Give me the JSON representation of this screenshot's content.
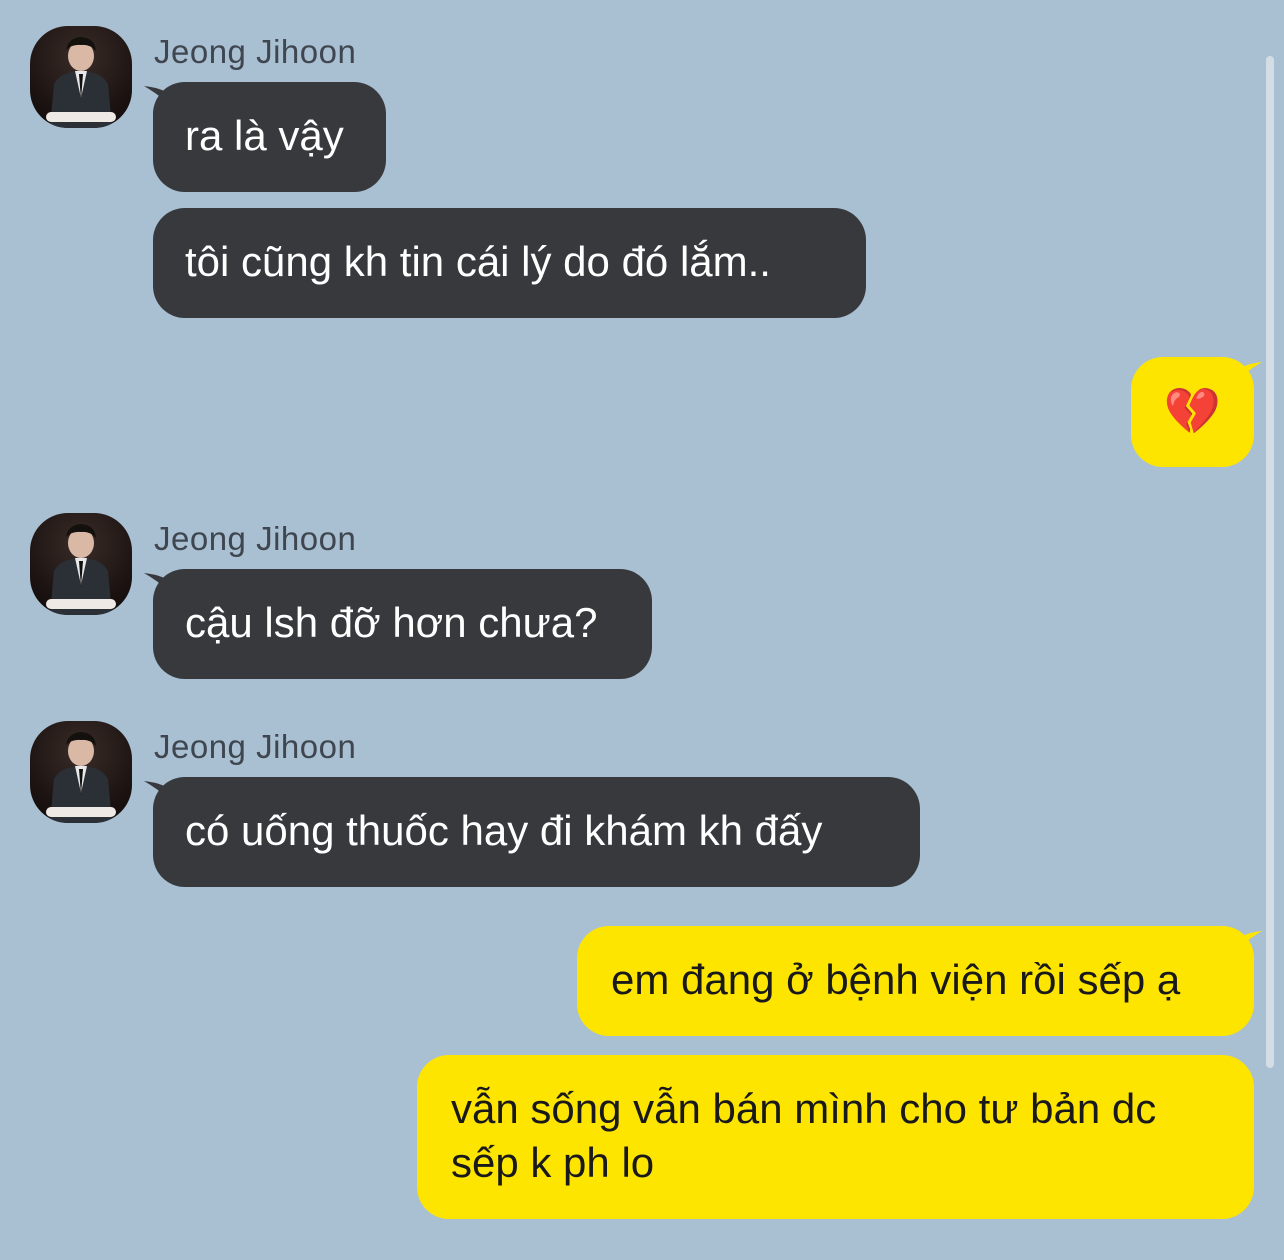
{
  "colors": {
    "background": "#a9bfd2",
    "incoming_bubble": "#38393d",
    "outgoing_bubble": "#fee500"
  },
  "messages": [
    {
      "sender": "Jeong Jihoon",
      "text": "ra là vậy"
    },
    {
      "text": "tôi cũng kh tin cái lý do đó lắm.."
    },
    {
      "text": "💔"
    },
    {
      "sender": "Jeong Jihoon",
      "text": "cậu lsh đỡ hơn chưa?"
    },
    {
      "sender": "Jeong Jihoon",
      "text": "có uống thuốc hay đi khám kh đấy"
    },
    {
      "text": "em đang ở bệnh viện rồi sếp ạ"
    },
    {
      "text": "vẫn sống vẫn bán mình cho tư bản dc\nsếp k ph lo"
    }
  ]
}
